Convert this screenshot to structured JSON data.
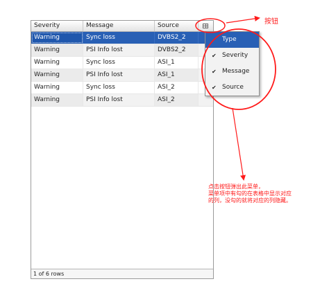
{
  "grid": {
    "columns": [
      "Severity",
      "Message",
      "Source"
    ],
    "rows": [
      {
        "severity": "Warning",
        "message": "Sync loss",
        "source": "DVBS2_2"
      },
      {
        "severity": "Warning",
        "message": "PSI Info lost",
        "source": "DVBS2_2"
      },
      {
        "severity": "Warning",
        "message": "Sync loss",
        "source": "ASI_1"
      },
      {
        "severity": "Warning",
        "message": "PSI Info lost",
        "source": "ASI_1"
      },
      {
        "severity": "Warning",
        "message": "Sync loss",
        "source": "ASI_2"
      },
      {
        "severity": "Warning",
        "message": "PSI Info lost",
        "source": "ASI_2"
      }
    ],
    "selected_row": 0,
    "footer": "1 of 6 rows"
  },
  "column_menu": {
    "items": [
      {
        "label": "Type",
        "checked": false
      },
      {
        "label": "Severity",
        "checked": true
      },
      {
        "label": "Message",
        "checked": true
      },
      {
        "label": "Source",
        "checked": true
      }
    ],
    "active_item": 0,
    "check_glyph": "✔"
  },
  "annotations": {
    "button_label": "按钮",
    "description_lines": [
      "点击按钮弹出此菜单，",
      "菜单项中有勾的在表格中显示对应",
      "的列，没勾的就将对应的列隐藏。"
    ],
    "color": "#ff1a1a"
  }
}
